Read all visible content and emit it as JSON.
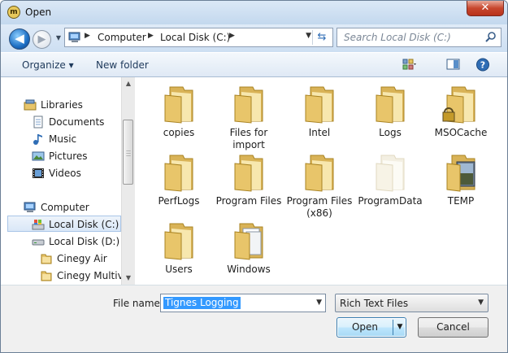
{
  "window": {
    "title": "Open",
    "close_glyph": "✕"
  },
  "nav": {
    "back_glyph": "◀",
    "forward_glyph": "▶",
    "address_crumbs": [
      "Computer",
      "Local Disk (C:)"
    ],
    "search_placeholder": "Search Local Disk (C:)"
  },
  "toolbar": {
    "organize_label": "Organize ▾",
    "new_folder_label": "New folder"
  },
  "sidebar": {
    "items": [
      {
        "label": "Libraries",
        "icon": "libraries-icon"
      },
      {
        "label": "Documents",
        "icon": "documents-icon"
      },
      {
        "label": "Music",
        "icon": "music-icon"
      },
      {
        "label": "Pictures",
        "icon": "pictures-icon"
      },
      {
        "label": "Videos",
        "icon": "videos-icon"
      },
      {
        "label": "Computer",
        "icon": "computer-icon"
      },
      {
        "label": "Local Disk (C:)",
        "icon": "system-drive-icon",
        "selected": true
      },
      {
        "label": "Local Disk (D:)",
        "icon": "drive-icon"
      },
      {
        "label": "Cinegy Air",
        "icon": "folder-icon"
      },
      {
        "label": "Cinegy Multivi",
        "icon": "folder-icon"
      }
    ]
  },
  "files": [
    {
      "name": "copies",
      "icon": "folder-icon"
    },
    {
      "name": "Files for import",
      "icon": "folder-icon"
    },
    {
      "name": "Intel",
      "icon": "folder-icon"
    },
    {
      "name": "Logs",
      "icon": "folder-icon"
    },
    {
      "name": "MSOCache",
      "icon": "locked-folder-icon"
    },
    {
      "name": "PerfLogs",
      "icon": "folder-icon"
    },
    {
      "name": "Program Files",
      "icon": "folder-icon"
    },
    {
      "name": "Program Files (x86)",
      "icon": "folder-icon"
    },
    {
      "name": "ProgramData",
      "icon": "hidden-folder-icon"
    },
    {
      "name": "TEMP",
      "icon": "picture-folder-icon"
    },
    {
      "name": "Users",
      "icon": "folder-icon"
    },
    {
      "name": "Windows",
      "icon": "document-folder-icon"
    }
  ],
  "bottom": {
    "file_name_label": "File name:",
    "file_name_value": "Tignes Logging",
    "file_type_value": "Rich Text Files",
    "open_label": "Open",
    "cancel_label": "Cancel"
  },
  "colors": {
    "accent": "#3399ff",
    "folder": "#e8c56a",
    "selection": "#d9e7f7"
  }
}
